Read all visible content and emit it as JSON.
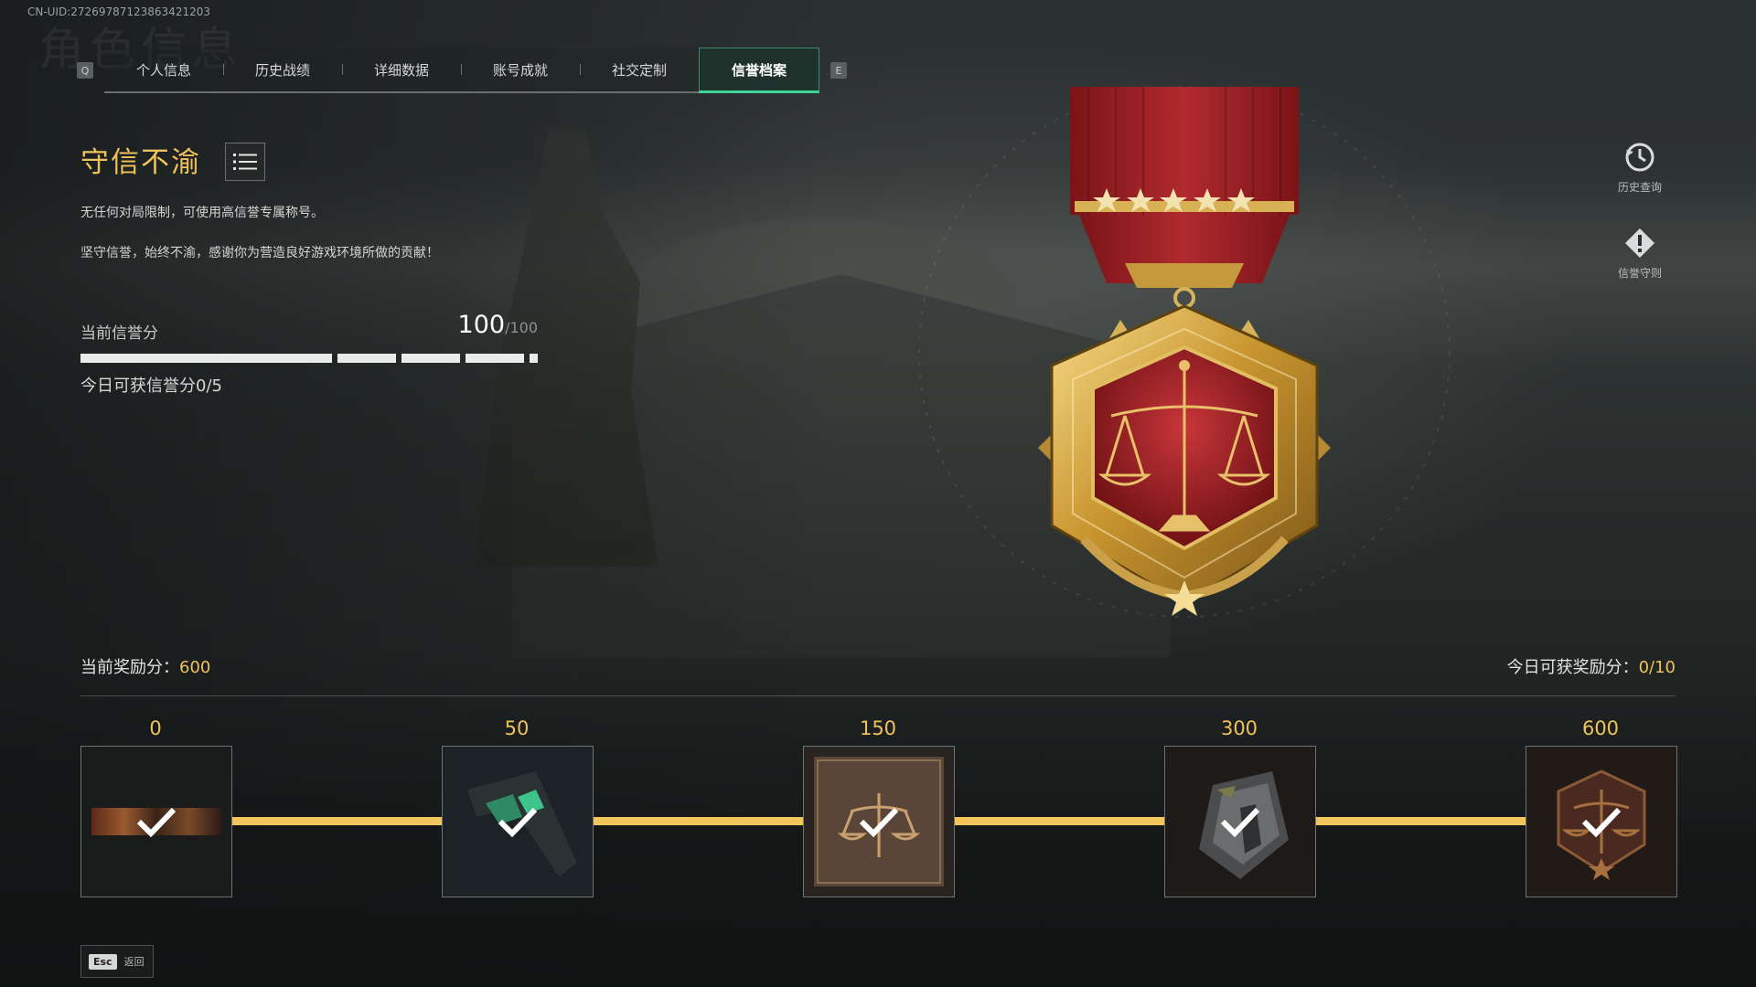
{
  "uid": "CN-UID:27269787123863421203",
  "ghost_title": "角色信息",
  "tabs": {
    "left_key": "Q",
    "right_key": "E",
    "items": [
      {
        "label": "个人信息"
      },
      {
        "label": "历史战绩"
      },
      {
        "label": "详细数据"
      },
      {
        "label": "账号成就"
      },
      {
        "label": "社交定制"
      },
      {
        "label": "信誉档案",
        "active": true
      }
    ]
  },
  "honor": {
    "title": "守信不渝",
    "desc1": "无任何对局限制，可使用高信誉专属称号。",
    "desc2": "坚守信誉，始终不渝，感谢你为营造良好游戏环境所做的贡献！",
    "score_label": "当前信誉分",
    "score": "100",
    "score_max": "/100",
    "daily_label": "今日可获信誉分0/5"
  },
  "side": {
    "history_label": "历史查询",
    "rules_label": "信誉守则"
  },
  "rewards": {
    "current_label": "当前奖励分：",
    "current_value": "600",
    "daily_label": "今日可获奖励分：",
    "daily_value": "0/10",
    "milestones": [
      {
        "value": "0",
        "icon": "banner-icon",
        "claimed": true
      },
      {
        "value": "50",
        "icon": "weapon-skin-icon",
        "claimed": true
      },
      {
        "value": "150",
        "icon": "scales-card-icon",
        "claimed": true
      },
      {
        "value": "300",
        "icon": "badge-icon",
        "claimed": true
      },
      {
        "value": "600",
        "icon": "scales-emblem-icon",
        "claimed": true
      }
    ]
  },
  "footer": {
    "esc_key": "Esc",
    "esc_label": "返回"
  },
  "colors": {
    "accent_gold": "#f0c25c",
    "tab_active": "#3fd49a",
    "medal_red": "#a8262a"
  }
}
